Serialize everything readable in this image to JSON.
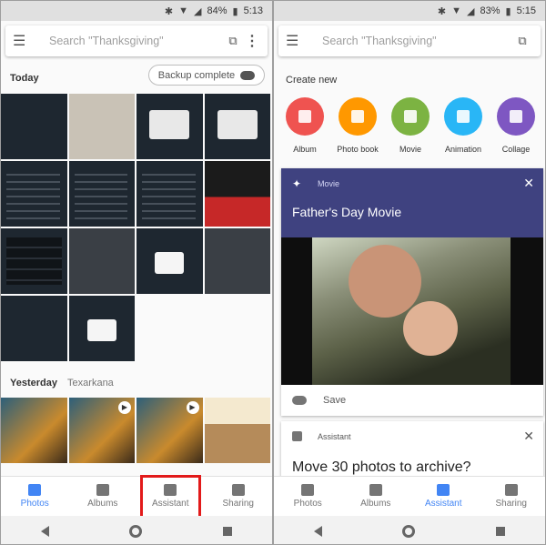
{
  "left": {
    "status": {
      "battery": "84%",
      "time": "5:13"
    },
    "search": {
      "placeholder": "Search \"Thanksgiving\""
    },
    "today_label": "Today",
    "backup_label": "Backup complete",
    "yesterday_label": "Yesterday",
    "yesterday_location": "Texarkana",
    "nav": [
      {
        "label": "Photos",
        "icon": "photos-icon",
        "active": true
      },
      {
        "label": "Albums",
        "icon": "albums-icon",
        "active": false
      },
      {
        "label": "Assistant",
        "icon": "assistant-icon",
        "active": false,
        "highlighted": true
      },
      {
        "label": "Sharing",
        "icon": "sharing-icon",
        "active": false
      }
    ]
  },
  "right": {
    "status": {
      "battery": "83%",
      "time": "5:15"
    },
    "search": {
      "placeholder": "Search \"Thanksgiving\""
    },
    "create_new_label": "Create new",
    "create_items": [
      {
        "label": "Album",
        "color": "#ef5350"
      },
      {
        "label": "Photo book",
        "color": "#ff9800"
      },
      {
        "label": "Movie",
        "color": "#7cb342"
      },
      {
        "label": "Animation",
        "color": "#29b6f6"
      },
      {
        "label": "Collage",
        "color": "#7e57c2"
      }
    ],
    "movie_card": {
      "tag": "Movie",
      "title": "Father's Day Movie",
      "save_label": "Save"
    },
    "assistant_card": {
      "tag": "Assistant",
      "title": "Move 30 photos to archive?"
    },
    "nav": [
      {
        "label": "Photos",
        "icon": "photos-icon",
        "active": false
      },
      {
        "label": "Albums",
        "icon": "albums-icon",
        "active": false
      },
      {
        "label": "Assistant",
        "icon": "assistant-icon",
        "active": true
      },
      {
        "label": "Sharing",
        "icon": "sharing-icon",
        "active": false
      }
    ]
  },
  "colors": {
    "accent": "#4285f4",
    "highlight": "#e21a1a",
    "movie_header": "#3f4280"
  }
}
